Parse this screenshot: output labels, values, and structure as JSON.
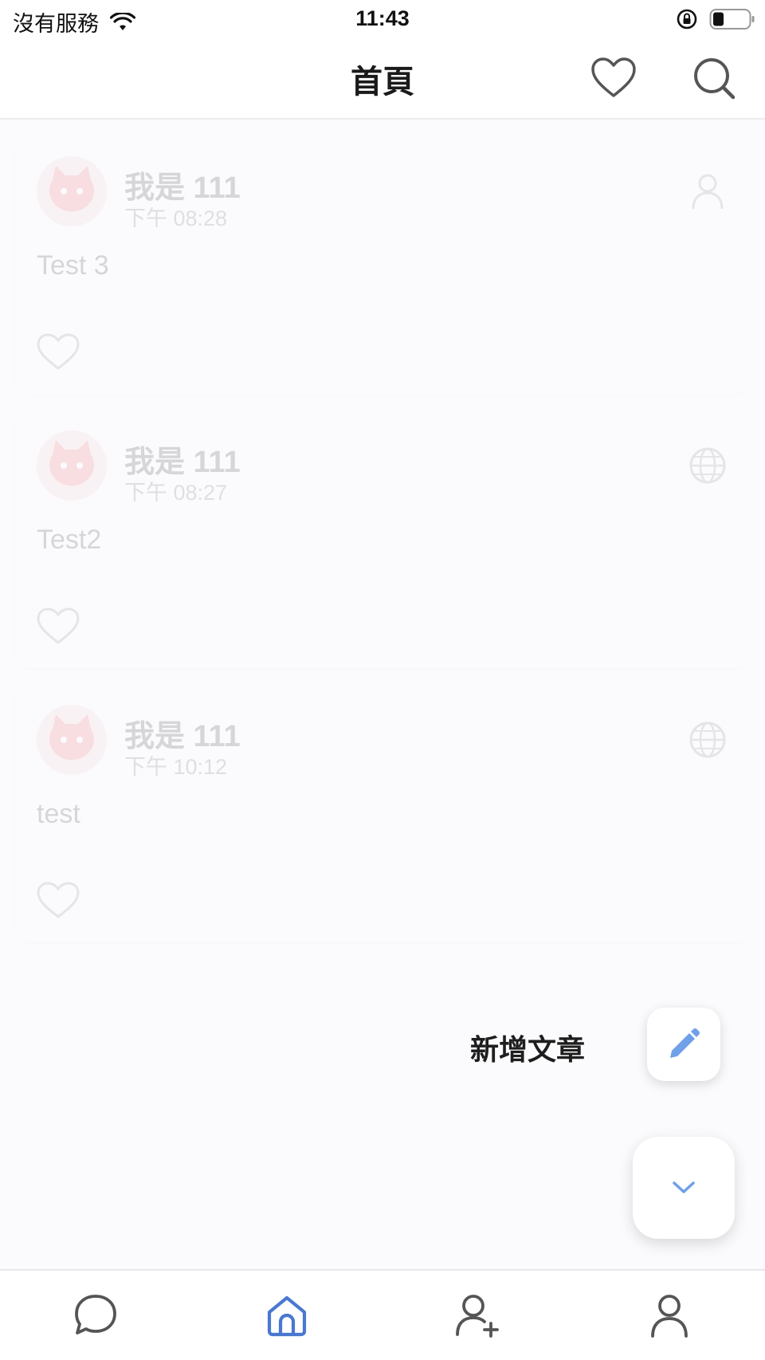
{
  "status_bar": {
    "carrier": "沒有服務",
    "time": "11:43"
  },
  "header": {
    "title": "首頁"
  },
  "posts": [
    {
      "name": "我是 111",
      "time": "下午 08:28",
      "text": "Test 3",
      "privacy_icon": "person-icon"
    },
    {
      "name": "我是 111",
      "time": "下午 08:27",
      "text": "Test2",
      "privacy_icon": "globe-icon"
    },
    {
      "name": "我是 111",
      "time": "下午 10:12",
      "text": "test",
      "privacy_icon": "globe-icon"
    }
  ],
  "fab_menu": {
    "add_post_label": "新增文章"
  },
  "colors": {
    "accent": "#4a78d0",
    "fab_icon": "#6fa0e8",
    "icon_gray": "#555555"
  },
  "bottom_nav": {
    "items": [
      {
        "icon": "chat-icon"
      },
      {
        "icon": "home-icon",
        "active": true
      },
      {
        "icon": "add-friend-icon"
      },
      {
        "icon": "profile-icon"
      }
    ]
  }
}
